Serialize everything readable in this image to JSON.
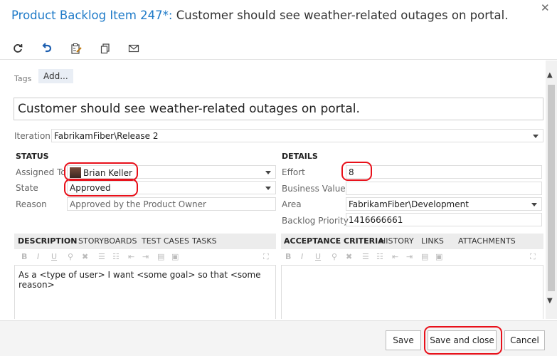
{
  "header": {
    "item_id": "Product Backlog Item 247*:",
    "item_title": "Customer should see weather-related outages on portal.",
    "close_glyph": "✕"
  },
  "toolbar": {
    "icons": [
      "refresh-icon",
      "undo-icon",
      "clipboard-icon",
      "copy-icon",
      "mail-icon"
    ]
  },
  "tags": {
    "label": "Tags",
    "add": "Add..."
  },
  "title_field": "Customer should see weather-related outages on portal.",
  "iteration": {
    "label": "Iteration",
    "value": "FabrikamFiber\\Release 2"
  },
  "status": {
    "heading": "STATUS",
    "assigned_to": {
      "label": "Assigned To",
      "value": "Brian Keller"
    },
    "state": {
      "label": "State",
      "value": "Approved"
    },
    "reason": {
      "label": "Reason",
      "value": "Approved by the Product Owner"
    }
  },
  "details": {
    "heading": "DETAILS",
    "effort": {
      "label": "Effort",
      "value": "8"
    },
    "business_value": {
      "label": "Business Value",
      "value": ""
    },
    "area": {
      "label": "Area",
      "value": "FabrikamFiber\\Development"
    },
    "backlog_priority": {
      "label": "Backlog Priority",
      "value": "1416666661"
    }
  },
  "left_tabs": [
    "DESCRIPTION",
    "STORYBOARDS",
    "TEST CASES",
    "TASKS"
  ],
  "right_tabs": [
    "ACCEPTANCE CRITERIA",
    "HISTORY",
    "LINKS",
    "ATTACHMENTS"
  ],
  "format": {
    "bold": "B",
    "italic": "I",
    "underline": "U"
  },
  "description_text": "As a <type of user> I want <some goal> so that <some reason>",
  "footer": {
    "save": "Save",
    "save_close": "Save and close",
    "cancel": "Cancel"
  },
  "colors": {
    "accent": "#1e7ac8",
    "highlight": "#e8101a"
  }
}
